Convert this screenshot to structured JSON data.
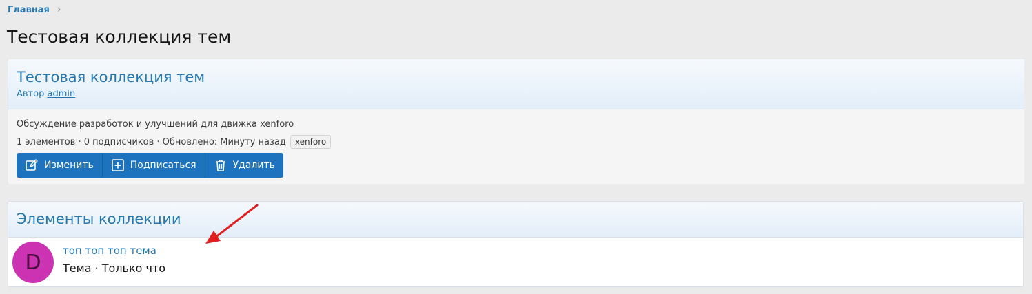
{
  "breadcrumb": {
    "home_label": "Главная",
    "chevron": "›"
  },
  "page_title": "Тестовая коллекция тем",
  "collection": {
    "title": "Тестовая коллекция тем",
    "author_prefix": "Автор",
    "author_name": "admin",
    "description": "Обсуждение разработок и улучшений для движка xenforo",
    "stats": "1 элементов · 0 подписчиков · Обновлено: Минуту назад",
    "tag": "xenforo",
    "buttons": [
      {
        "label": "Изменить",
        "icon": "edit-icon"
      },
      {
        "label": "Подписаться",
        "icon": "plus-square-icon"
      },
      {
        "label": "Удалить",
        "icon": "trash-icon"
      }
    ]
  },
  "items_section": {
    "title": "Элементы коллекции",
    "items": [
      {
        "avatar_letter": "D",
        "title": "топ топ топ тема",
        "meta": "Тема · Только что"
      }
    ]
  },
  "colors": {
    "link": "#2577b1",
    "button_bg": "#1e73be",
    "avatar_bg": "#cc33b3",
    "annotation_arrow": "#e02020"
  }
}
